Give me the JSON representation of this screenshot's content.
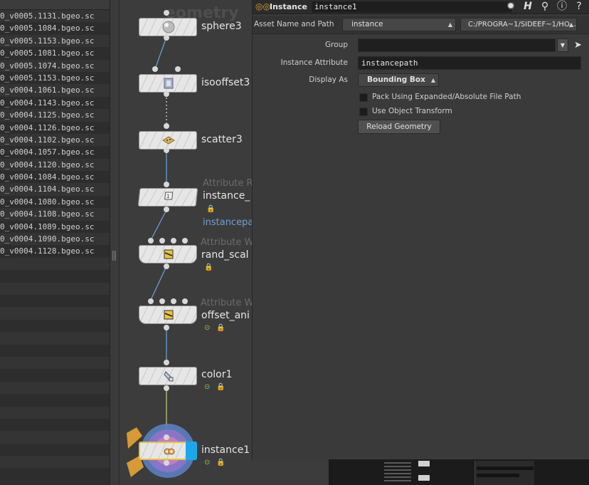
{
  "file_list": {
    "rows": [
      "0_v0005.1131.bgeo.sc",
      "0_v0005.1084.bgeo.sc",
      "0_v0005.1153.bgeo.sc",
      "0_v0005.1081.bgeo.sc",
      "0_v0005.1074.bgeo.sc",
      "0_v0005.1153.bgeo.sc",
      "0_v0004.1061.bgeo.sc",
      "0_v0004.1143.bgeo.sc",
      "0_v0004.1125.bgeo.sc",
      "0_v0004.1126.bgeo.sc",
      "0_v0004.1102.bgeo.sc",
      "0_v0004.1057.bgeo.sc",
      "0_v0004.1120.bgeo.sc",
      "0_v0004.1084.bgeo.sc",
      "0_v0004.1104.bgeo.sc",
      "0_v0004.1080.bgeo.sc",
      "0_v0004.1108.bgeo.sc",
      "0_v0004.1089.bgeo.sc",
      "0_v0004.1090.bgeo.sc",
      "0_v0004.1128.bgeo.sc"
    ]
  },
  "network": {
    "title": "eometry",
    "nodes": [
      {
        "label": "sphere3",
        "type": "",
        "icon": "sphere-icon"
      },
      {
        "label": "isooffset3",
        "type": "",
        "icon": "isooffset-icon"
      },
      {
        "label": "scatter3",
        "type": "",
        "icon": "scatter-icon"
      },
      {
        "label": "instance_",
        "type": "Attribute R",
        "icon": "attribute-rename-icon",
        "link": "instancepa"
      },
      {
        "label": "rand_scal",
        "type": "Attribute W",
        "icon": "attribute-wrangle-icon"
      },
      {
        "label": "offset_ani",
        "type": "Attribute W",
        "icon": "attribute-wrangle-icon"
      },
      {
        "label": "color1",
        "type": "",
        "icon": "color-icon"
      },
      {
        "label": "instance1",
        "type": "",
        "icon": "instance-icon"
      }
    ]
  },
  "params": {
    "header": {
      "op_type": "Instance",
      "op_name": "instance1"
    },
    "asset": {
      "label": "Asset Name and Path",
      "name": "instance",
      "path": "C:/PROGRA~1/SIDEEF~1/HO..."
    },
    "group": {
      "label": "Group",
      "value": ""
    },
    "instance_attribute": {
      "label": "Instance Attribute",
      "value": "instancepath"
    },
    "display_as": {
      "label": "Display As",
      "value": "Bounding Box"
    },
    "pack_expanded": {
      "label": "Pack Using Expanded/Absolute File Path",
      "checked": false
    },
    "use_object_transform": {
      "label": "Use Object Transform",
      "checked": false
    },
    "reload_button": "Reload Geometry"
  },
  "colors": {
    "selected_node": "#1aa8e8",
    "wire": "#6a9bd8",
    "display_flag": "#8dcf5a"
  }
}
